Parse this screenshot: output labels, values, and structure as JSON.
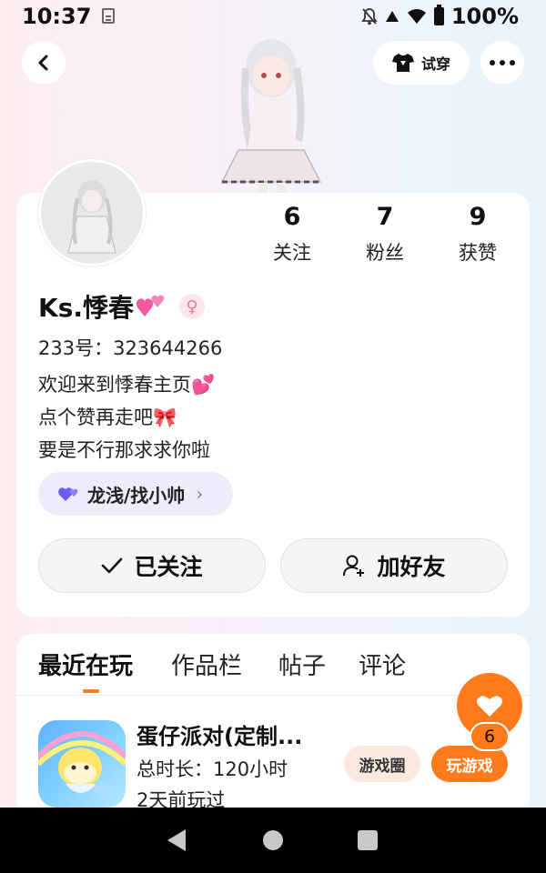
{
  "status": {
    "time": "10:37",
    "battery": "100%"
  },
  "header": {
    "tryon_label": "试穿"
  },
  "profile": {
    "name": "Ks.悸春",
    "uid": "233号：323644266",
    "bio": [
      "欢迎来到悸春主页💕",
      "点个赞再走吧🎀",
      "要是不行那求求你啦"
    ],
    "tag": "龙浅/找小帅",
    "stats": [
      {
        "value": "6",
        "label": "关注"
      },
      {
        "value": "7",
        "label": "粉丝"
      },
      {
        "value": "9",
        "label": "获赞"
      }
    ]
  },
  "actions": {
    "follow_label": "已关注",
    "add_friend_label": "加好友"
  },
  "tabs": [
    "最近在玩",
    "作品栏",
    "帖子",
    "评论"
  ],
  "game": {
    "title": "蛋仔派对(定制...",
    "duration": "总时长：120小时",
    "last_played": "2天前玩过",
    "circle_label": "游戏圈",
    "play_label": "玩游戏"
  },
  "like": {
    "count": "6"
  },
  "colors": {
    "accent": "#ff7a1a",
    "tag_bg": "#ececfb",
    "gender_pink": "#f07896"
  }
}
